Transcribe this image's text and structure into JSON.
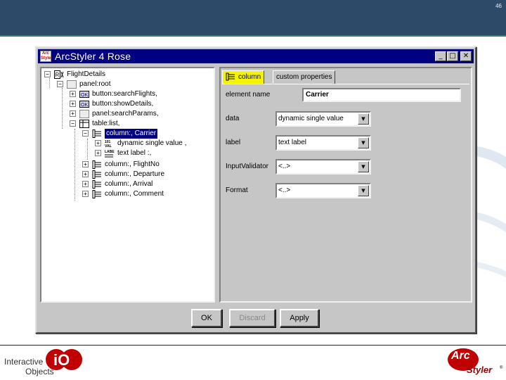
{
  "slide": {
    "page_number": "46"
  },
  "window": {
    "title": "ArcStyler 4 Rose",
    "app_icon_text": "Arc Styler",
    "min_glyph": "_",
    "max_glyph": "□",
    "close_glyph": "✕"
  },
  "tree": {
    "nodes": [
      {
        "label": "FlightDetails",
        "expander": "−",
        "icon": "root"
      },
      {
        "label": "panel:root",
        "expander": "−",
        "icon": "panel"
      },
      {
        "label": "button:searchFlights,",
        "expander": "+",
        "icon": "button"
      },
      {
        "label": "button:showDetails,",
        "expander": "+",
        "icon": "button"
      },
      {
        "label": "panel:searchParams,",
        "expander": "+",
        "icon": "panel"
      },
      {
        "label": "table:list,",
        "expander": "−",
        "icon": "table"
      },
      {
        "label": "column:, Carrier",
        "expander": "−",
        "icon": "column",
        "selected": true
      },
      {
        "label": "dynamic single value ,",
        "expander": "+",
        "icon": "widget-dsv"
      },
      {
        "label": "text label :,",
        "expander": "+",
        "icon": "widget-label"
      },
      {
        "label": "column:, FlightNo",
        "expander": "+",
        "icon": "column"
      },
      {
        "label": "column:, Departure",
        "expander": "+",
        "icon": "column"
      },
      {
        "label": "column:, Arrival",
        "expander": "+",
        "icon": "column"
      },
      {
        "label": "column:, Comment",
        "expander": "+",
        "icon": "column"
      }
    ]
  },
  "props": {
    "tabs": {
      "column": "column",
      "custom": "custom properties"
    },
    "element_name": {
      "label": "element name",
      "value": "Carrier"
    },
    "data": {
      "label": "data",
      "value": "dynamic single value"
    },
    "label": {
      "label": "label",
      "value": "text label"
    },
    "input_validator": {
      "label": "InputValidator",
      "value": "<..>"
    },
    "format": {
      "label": "Format",
      "value": "<..>"
    },
    "arrow_glyph": "▼"
  },
  "buttons": {
    "ok": "OK",
    "discard": "Discard",
    "apply": "Apply"
  },
  "footer": {
    "io_line1": "Interactive",
    "io_line2": "Objects",
    "io_mark": "iO",
    "as_arc": "Arc",
    "as_styler": "Styler",
    "as_reg": "®"
  },
  "colors": {
    "top_band": "#2d4a68",
    "titlebar": "#000080",
    "selection": "#000080",
    "active_tab": "#f4f400",
    "logo_red": "#c00000"
  }
}
